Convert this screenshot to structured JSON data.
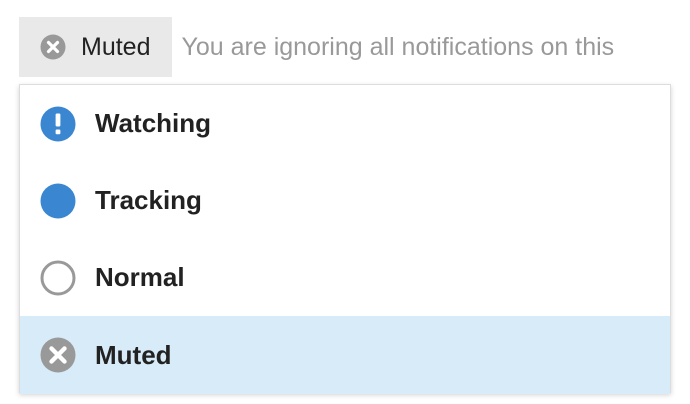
{
  "notification_button": {
    "label": "Muted",
    "icon": "times-circle-icon"
  },
  "hint_text": "You are ignoring all notifications on this",
  "colors": {
    "accent_blue": "#3a86d1",
    "muted_grey": "#999999",
    "selected_bg": "#d7ebf8",
    "button_bg": "#e9e9e9"
  },
  "dropdown": {
    "items": [
      {
        "label": "Watching",
        "icon": "exclamation-circle-icon"
      },
      {
        "label": "Tracking",
        "icon": "filled-circle-icon"
      },
      {
        "label": "Normal",
        "icon": "empty-circle-icon"
      },
      {
        "label": "Muted",
        "icon": "times-circle-icon",
        "selected": true
      }
    ]
  }
}
